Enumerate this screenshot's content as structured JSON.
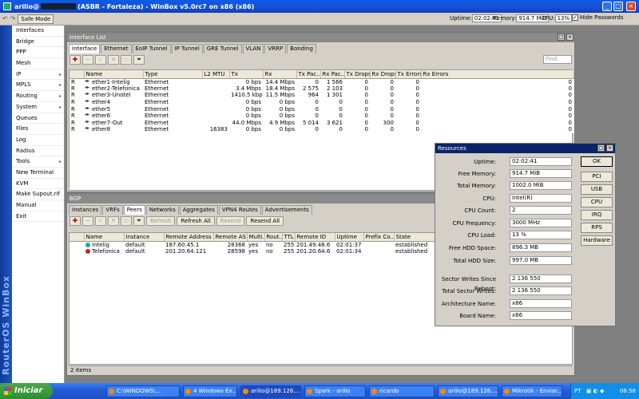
{
  "window": {
    "title_user": "arilio@",
    "title_rest": "(ASBR - Fortaleza) - WinBox v5.0rc7 on x86 (x86)"
  },
  "toolbar": {
    "safe_mode": "Safe Mode",
    "uptime_label": "Uptime:",
    "uptime": "02:02:41",
    "memory_label": "Memory:",
    "memory": "914.7 MiB",
    "cpu_label": "CPU:",
    "cpu": "13%",
    "hide_passwords": "Hide Passwords"
  },
  "brand_text": "RouterOS WinBox",
  "menu": [
    {
      "label": "Interfaces",
      "sub": false
    },
    {
      "label": "Bridge",
      "sub": false
    },
    {
      "label": "PPP",
      "sub": false
    },
    {
      "label": "Mesh",
      "sub": false
    },
    {
      "label": "IP",
      "sub": true
    },
    {
      "label": "MPLS",
      "sub": true
    },
    {
      "label": "Routing",
      "sub": true
    },
    {
      "label": "System",
      "sub": true
    },
    {
      "label": "Queues",
      "sub": false
    },
    {
      "label": "Files",
      "sub": false
    },
    {
      "label": "Log",
      "sub": false
    },
    {
      "label": "Radius",
      "sub": false
    },
    {
      "label": "Tools",
      "sub": true
    },
    {
      "label": "New Terminal",
      "sub": false
    },
    {
      "label": "KVM",
      "sub": false
    },
    {
      "label": "Make Supout.rif",
      "sub": false
    },
    {
      "label": "Manual",
      "sub": false
    },
    {
      "label": "Exit",
      "sub": false
    }
  ],
  "interface_list": {
    "title": "Interface List",
    "tabs": [
      "Interface",
      "Ethernet",
      "EoIP Tunnel",
      "IP Tunnel",
      "GRE Tunnel",
      "VLAN",
      "VRRP",
      "Bonding"
    ],
    "find_placeholder": "Find",
    "columns": [
      "",
      "Name",
      "Type",
      "L2 MTU",
      "Tx",
      "Rx",
      "Tx Pac...",
      "Rx Pac...",
      "Tx Drops",
      "Rx Drops",
      "Tx Errors",
      "Rx Errors"
    ],
    "rows": [
      [
        "R",
        "ether1-Intelig",
        "Ethernet",
        "",
        "0 bps",
        "14.4 Mbps",
        "0",
        "1 566",
        "0",
        "0",
        "0",
        "0"
      ],
      [
        "R",
        "ether2-Telefonica",
        "Ethernet",
        "",
        "3.4 Mbps",
        "18.4 Mbps",
        "2 575",
        "2 103",
        "0",
        "0",
        "0",
        "0"
      ],
      [
        "R",
        "ether3-Unotel",
        "Ethernet",
        "",
        "1410.5 kbps",
        "11.5 Mbps",
        "964",
        "1 301",
        "0",
        "0",
        "0",
        "0"
      ],
      [
        "R",
        "ether4",
        "Ethernet",
        "",
        "0 bps",
        "0 bps",
        "0",
        "0",
        "0",
        "0",
        "0",
        "0"
      ],
      [
        "R",
        "ether5",
        "Ethernet",
        "",
        "0 bps",
        "0 bps",
        "0",
        "0",
        "0",
        "0",
        "0",
        "0"
      ],
      [
        "R",
        "ether6",
        "Ethernet",
        "",
        "0 bps",
        "0 bps",
        "0",
        "0",
        "0",
        "0",
        "0",
        "0"
      ],
      [
        "R",
        "ether7-Out",
        "Ethernet",
        "",
        "44.0 Mbps",
        "4.9 Mbps",
        "5 014",
        "3 621",
        "0",
        "300",
        "0",
        "0"
      ],
      [
        "R",
        "ether8",
        "Ethernet",
        "16383",
        "0 bps",
        "0 bps",
        "0",
        "0",
        "0",
        "0",
        "0",
        "0"
      ]
    ]
  },
  "bgp": {
    "title": "BGP",
    "tabs": [
      "Instances",
      "VRFs",
      "Peers",
      "Networks",
      "Aggregates",
      "VPN4 Routes",
      "Advertisements"
    ],
    "buttons": {
      "refresh": "Refresh",
      "refresh_all": "Refresh All",
      "resend": "Resend",
      "resend_all": "Resend All"
    },
    "columns": [
      "Name",
      "Instance",
      "Remote Address",
      "Remote AS",
      "Multi...",
      "Rout...",
      "TTL",
      "Remote ID",
      "Uptime",
      "Prefix Co...",
      "State"
    ],
    "rows": [
      [
        "Intelig",
        "default",
        "187.60.45.1",
        "28368",
        "yes",
        "no",
        "255",
        "201.49.48.6",
        "02:01:37",
        "",
        "established"
      ],
      [
        "Telefonica",
        "default",
        "201.20.64.121",
        "28598",
        "yes",
        "no",
        "255",
        "201.20.64.6",
        "02:01:34",
        "",
        "established"
      ]
    ],
    "status": "2 items"
  },
  "resources": {
    "title": "Resources",
    "fields": [
      {
        "label": "Uptime:",
        "value": "02:02:41"
      },
      {
        "label": "Free Memory:",
        "value": "914.7 MiB"
      },
      {
        "label": "Total Memory:",
        "value": "1002.0 MiB"
      },
      {
        "label": "CPU:",
        "value": "Intel(R)"
      },
      {
        "label": "CPU Count:",
        "value": "2"
      },
      {
        "label": "CPU Frequency:",
        "value": "3000 MHz"
      },
      {
        "label": "CPU Load:",
        "value": "13 %"
      },
      {
        "label": "Free HDD Space:",
        "value": "896.3 MB"
      },
      {
        "label": "Total HDD Size:",
        "value": "997.0 MB"
      },
      {
        "label": "Sector Writes Since Reboot:",
        "value": "2 136 550"
      },
      {
        "label": "Total Sector Writes:",
        "value": "2 136 550"
      },
      {
        "label": "Architecture Name:",
        "value": "x86"
      },
      {
        "label": "Board Name:",
        "value": "x86"
      }
    ],
    "buttons": [
      "OK",
      "PCI",
      "USB",
      "CPU",
      "IRQ",
      "RPS",
      "Hardware"
    ]
  },
  "taskbar": {
    "start": "Iniciar",
    "tasks": [
      "C:\\WINDOWS\\...",
      "4 Windows Ex...",
      "arilio@189.126....",
      "Spark - arilio",
      "ricardo",
      "arilio@189.126....",
      "Mikrotik - Enviar..."
    ],
    "lang": "PT",
    "clock": "08:58"
  }
}
